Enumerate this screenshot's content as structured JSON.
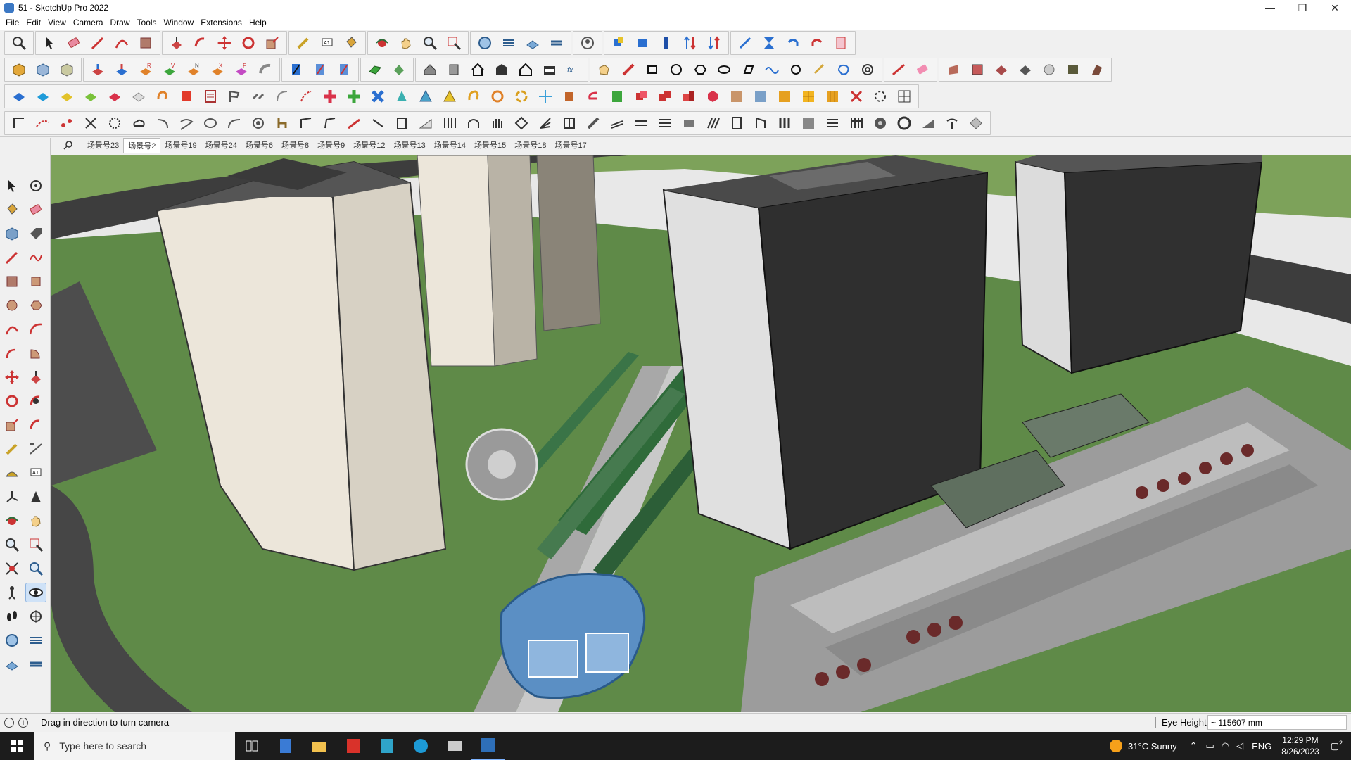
{
  "window": {
    "title": "51 - SketchUp Pro 2022",
    "controls": [
      "—",
      "❐",
      "✕"
    ]
  },
  "menu": [
    "File",
    "Edit",
    "View",
    "Camera",
    "Draw",
    "Tools",
    "Window",
    "Extensions",
    "Help"
  ],
  "scenes": {
    "tabs": [
      "场景号23",
      "场景号2",
      "场景号19",
      "场景号24",
      "场景号6",
      "场景号8",
      "场景号9",
      "场景号12",
      "场景号13",
      "场景号14",
      "场景号15",
      "场景号18",
      "场景号17"
    ],
    "active_index": 1
  },
  "status": {
    "message": "Drag in direction to turn camera",
    "measure_label": "Eye Height",
    "measure_value": "~ 115607 mm"
  },
  "taskbar": {
    "search_placeholder": "Type here to search",
    "weather": "31°C  Sunny",
    "language": "ENG",
    "time": "12:29 PM",
    "date": "8/26/2023",
    "notification_count": "2"
  },
  "colors": {
    "grass": "#5f8a48",
    "road": "#4a4a4a",
    "water": "#5b8fc4",
    "tower_light": "#ece6da",
    "tower_dark": "#2f2f2f",
    "selection": "#cfe2f7"
  }
}
